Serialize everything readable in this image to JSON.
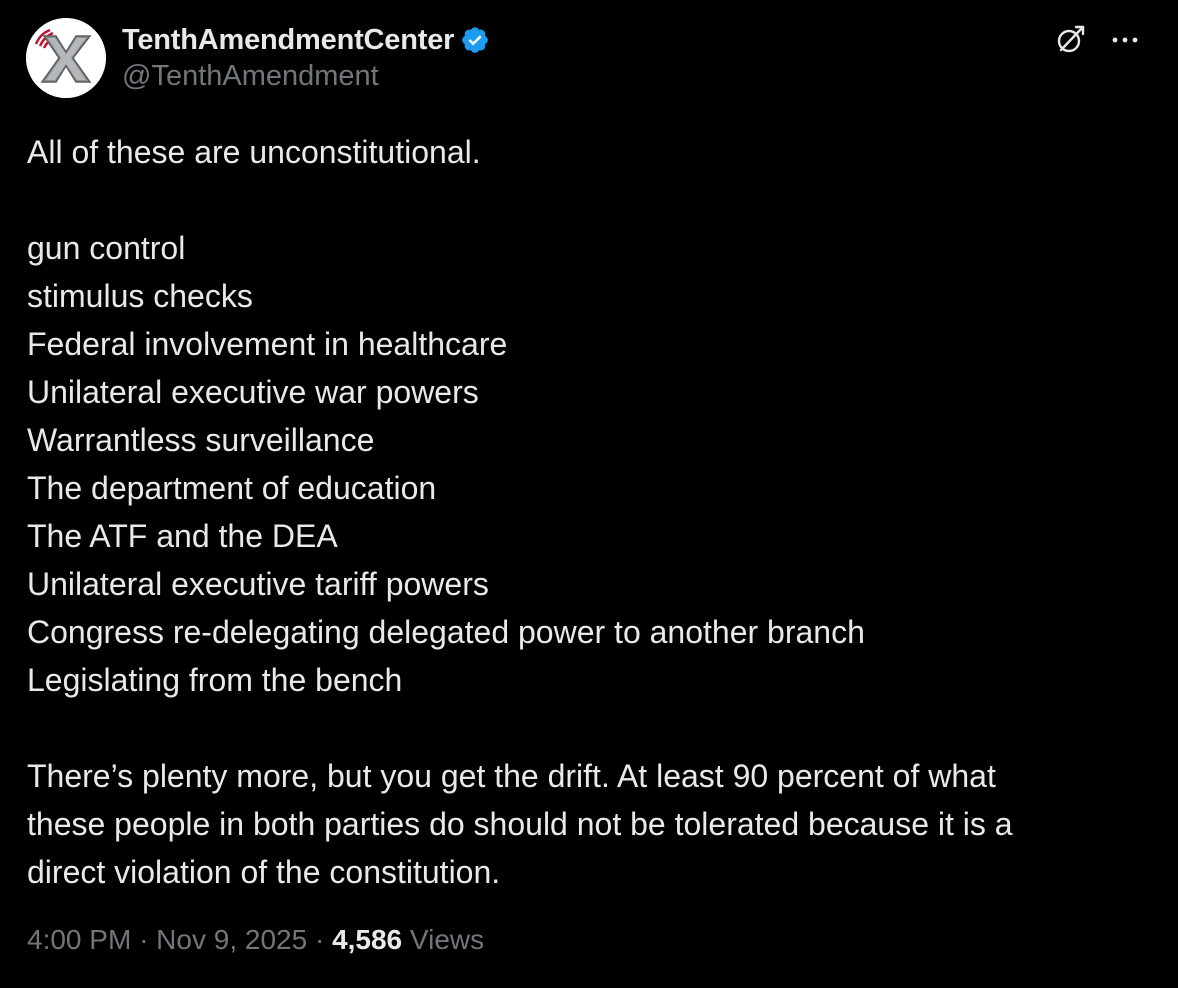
{
  "author": {
    "display_name": "TenthAmendmentCenter",
    "handle": "@TenthAmendment",
    "verified": true,
    "avatar_icon": "tenth-amendment-x-logo",
    "verified_color": "#1d9bf0"
  },
  "actions": {
    "grok_icon": "grok-icon",
    "more_icon": "more-options-icon"
  },
  "tweet": {
    "intro": "All of these are unconstitutional.",
    "items": [
      "gun control",
      "stimulus checks",
      "Federal involvement in healthcare",
      "Unilateral executive war powers",
      "Warrantless surveillance",
      "The department of education",
      "The ATF and the DEA",
      "Unilateral executive tariff powers",
      "Congress re-delegating delegated power to another branch",
      "Legislating from the bench"
    ],
    "closing_line_1": "There’s plenty more, but you get the drift.  At least 90 percent of what",
    "closing_line_2": "these people in both parties do should not be tolerated because it is a",
    "closing_line_3": "direct violation of the constitution."
  },
  "meta": {
    "time": "4:00 PM",
    "separator": "·",
    "date": "Nov 9, 2025",
    "views_count": "4,586",
    "views_label": "Views"
  },
  "colors": {
    "background": "#000000",
    "text": "#e7e9ea",
    "muted": "#71767b",
    "accent": "#1d9bf0"
  }
}
